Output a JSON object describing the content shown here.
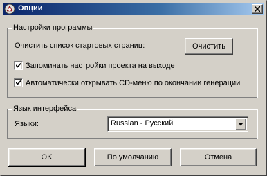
{
  "window": {
    "title": "Опции",
    "app_icon": "app-logo-icon",
    "close_icon": "close-icon"
  },
  "program_settings": {
    "title": "Настройки программы",
    "clear_label": "Очистить список стартовых страниц:",
    "clear_button": "Очистить",
    "remember_settings": {
      "label": "Запоминать настройки проекта на выходе",
      "checked": true
    },
    "auto_open_cd_menu": {
      "label": "Автоматически открывать CD-меню по окончании генерации",
      "checked": true
    }
  },
  "language": {
    "title": "Язык интерфейса",
    "label": "Языки:",
    "selected": "Russian - Русский"
  },
  "footer": {
    "ok": "OK",
    "defaults": "По умолчанию",
    "cancel": "Отмена"
  }
}
